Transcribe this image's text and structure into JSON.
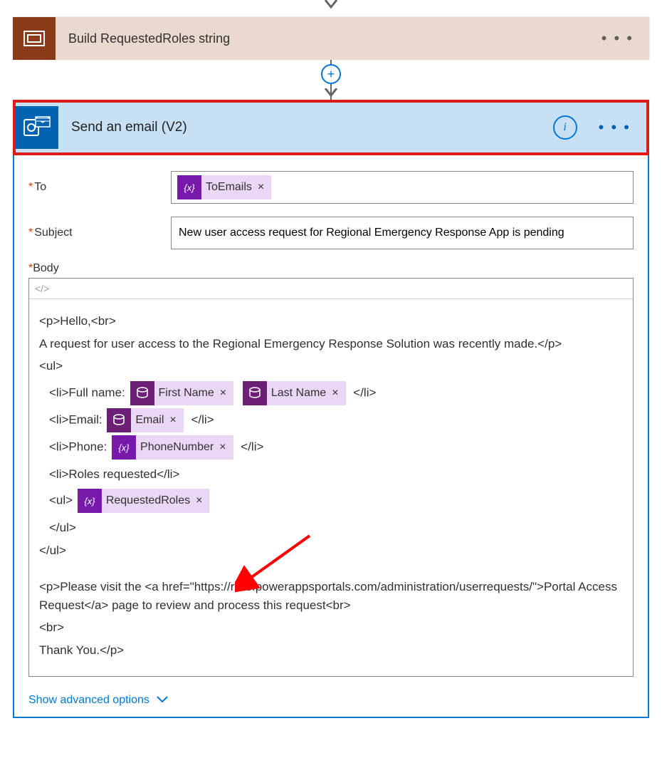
{
  "action_collapsed": {
    "title": "Build RequestedRoles string"
  },
  "action_selected": {
    "title": "Send an email (V2)"
  },
  "form": {
    "to_label": "To",
    "subject_label": "Subject",
    "subject_value": "New user access request for Regional Emergency Response App is pending",
    "body_label": "Body",
    "code_toggle": "</>"
  },
  "pills": {
    "to_emails": "ToEmails",
    "first_name": "First Name",
    "last_name": "Last Name",
    "email": "Email",
    "phone": "PhoneNumber",
    "requested_roles": "RequestedRoles",
    "x": "×"
  },
  "body": {
    "l1": "<p>Hello,<br>",
    "l2": "A request for user access to the Regional Emergency Response Solution was recently made.</p>",
    "l3": "<ul>",
    "l4a": "<li>Full name:",
    "l4b": "</li>",
    "l5a": "<li>Email:",
    "l5b": "</li>",
    "l6a": "<li>Phone:",
    "l6b": "</li>",
    "l7": "<li>Roles requested</li>",
    "l8a": "<ul>",
    "l9": "</ul>",
    "l10": "</ul>",
    "l11": "<p>Please visit the <a href=\"https://rer6.powerappsportals.com/administration/userrequests/\">Portal Access Request</a> page to review and process this request<br>",
    "l12": "<br>",
    "l13": "Thank You.</p>"
  },
  "advanced_label": "Show advanced options"
}
